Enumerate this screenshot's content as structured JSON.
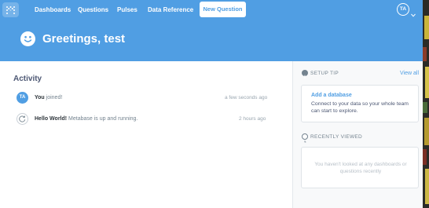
{
  "nav": {
    "links": [
      "Dashboards",
      "Questions",
      "Pulses",
      "Data Reference"
    ],
    "new_question": "New Question",
    "user_initials": "TA"
  },
  "header": {
    "greeting": "Greetings, test"
  },
  "activity": {
    "title": "Activity",
    "items": [
      {
        "avatar": "TA",
        "actor": "You",
        "text": "joined!",
        "time": "a few seconds ago"
      },
      {
        "actor": "Hello World!",
        "text": "Metabase is up and running.",
        "time": "2 hours ago"
      }
    ]
  },
  "sidebar": {
    "setup_tip": {
      "title": "SETUP TIP",
      "view_all": "View all",
      "link": "Add a database",
      "body": "Connect to your data so your whole team can start to explore."
    },
    "recently_viewed": {
      "title": "RECENTLY VIEWED",
      "empty": "You haven't looked at any dashboards or questions recently"
    }
  },
  "colors": {
    "brand": "#509ee3",
    "text_dark": "#2e353b",
    "text_medium": "#74838f",
    "sidebar_bg": "#f8f9fa"
  },
  "icons": [
    "metabase-logo-icon",
    "smiley-icon",
    "chevron-down-icon",
    "refresh-icon",
    "info-icon",
    "clock-icon"
  ]
}
